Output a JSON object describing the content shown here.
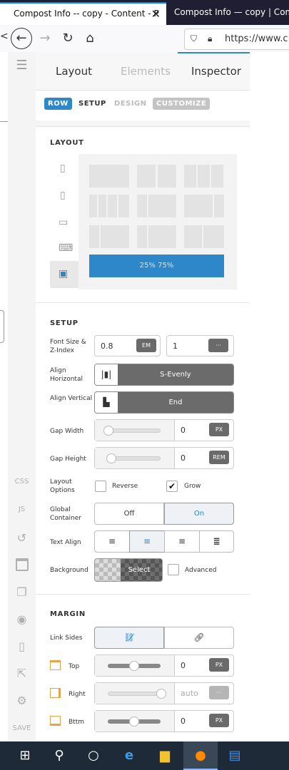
{
  "browser": {
    "tabs": [
      {
        "title": "Compost Info -- copy - Content - P"
      },
      {
        "title": "Compost Info — copy | Compo"
      }
    ],
    "url": "https://www.c"
  },
  "sidebar": {
    "items": [
      {
        "label": "CSS"
      },
      {
        "label": "JS"
      },
      {
        "label": "SAVE"
      }
    ]
  },
  "panel": {
    "tabs": [
      "Layout",
      "Elements",
      "Inspector"
    ],
    "subtabs": [
      "ROW",
      "SETUP",
      "DESIGN",
      "CUSTOMIZE"
    ],
    "layout": {
      "title": "LAYOUT",
      "selected_layout": "25% 75%"
    },
    "setup": {
      "title": "SETUP",
      "font_size_label": "Font Size & Z-Index",
      "font_size_value": "0.8",
      "font_size_unit": "EM",
      "z_index_value": "1",
      "z_index_unit": "···",
      "align_h_label": "Align Horizontal",
      "align_h_value": "S-Evenly",
      "align_v_label": "Align Vertical",
      "align_v_value": "End",
      "gap_width_label": "Gap Width",
      "gap_width_value": "0",
      "gap_width_unit": "PX",
      "gap_height_label": "Gap Height",
      "gap_height_value": "0",
      "gap_height_unit": "REM",
      "layout_options_label": "Layout Options",
      "reverse_label": "Reverse",
      "reverse_checked": false,
      "grow_label": "Grow",
      "grow_checked": true,
      "global_container_label": "Global Container",
      "global_off": "Off",
      "global_on": "On",
      "text_align_label": "Text Align",
      "background_label": "Background",
      "background_select": "Select",
      "advanced_label": "Advanced"
    },
    "margin": {
      "title": "MARGIN",
      "link_sides_label": "Link Sides",
      "top_label": "Top",
      "top_value": "0",
      "top_unit": "PX",
      "right_label": "Right",
      "right_value": "auto",
      "right_unit": "···",
      "bottom_label": "Bttm",
      "bottom_value": "0",
      "bottom_unit": "PX"
    }
  },
  "colors": {
    "accent_blue": "#2d87c8",
    "active_row_tab": "#2d87c8",
    "dark_control": "#6b6b6b",
    "taskbar": "#1e2a38"
  }
}
